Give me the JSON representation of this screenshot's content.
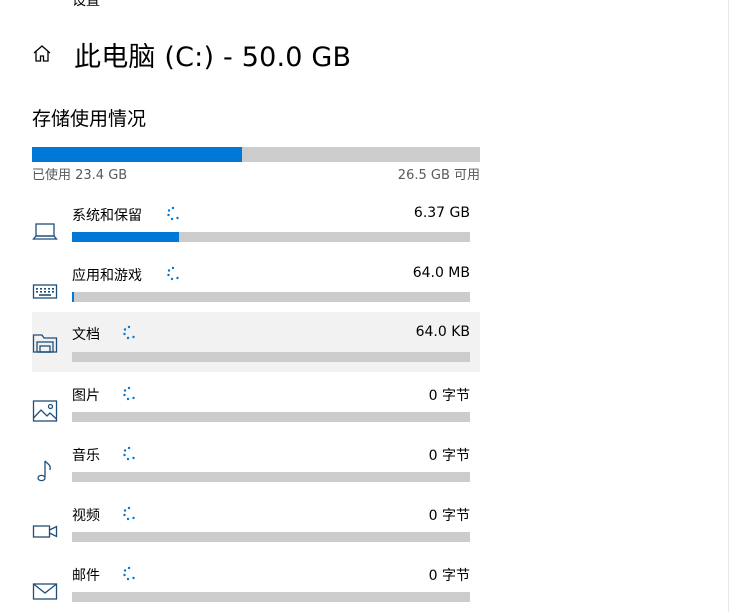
{
  "window": {
    "clipped_title": "设置"
  },
  "header": {
    "title": "此电脑 (C:) - 50.0 GB"
  },
  "storage": {
    "section_title": "存储使用情况",
    "used_text": "已使用 23.4 GB",
    "free_text": "26.5 GB 可用",
    "used_fraction": 0.468
  },
  "categories": [
    {
      "label": "系统和保留",
      "size": "6.37 GB",
      "fraction": 0.27,
      "icon": "laptop-icon"
    },
    {
      "label": "应用和游戏",
      "size": "64.0 MB",
      "fraction": 0.004,
      "icon": "keyboard-icon"
    },
    {
      "label": "文档",
      "size": "64.0 KB",
      "fraction": 0.0,
      "icon": "folder-icon"
    },
    {
      "label": "图片",
      "size": "0 字节",
      "fraction": 0.0,
      "icon": "picture-icon"
    },
    {
      "label": "音乐",
      "size": "0 字节",
      "fraction": 0.0,
      "icon": "music-note-icon"
    },
    {
      "label": "视频",
      "size": "0 字节",
      "fraction": 0.0,
      "icon": "video-camera-icon"
    },
    {
      "label": "邮件",
      "size": "0 字节",
      "fraction": 0.0,
      "icon": "mail-icon"
    }
  ],
  "colors": {
    "accent": "#0078d7",
    "track": "#cccccc",
    "hover": "#f2f2f2"
  }
}
